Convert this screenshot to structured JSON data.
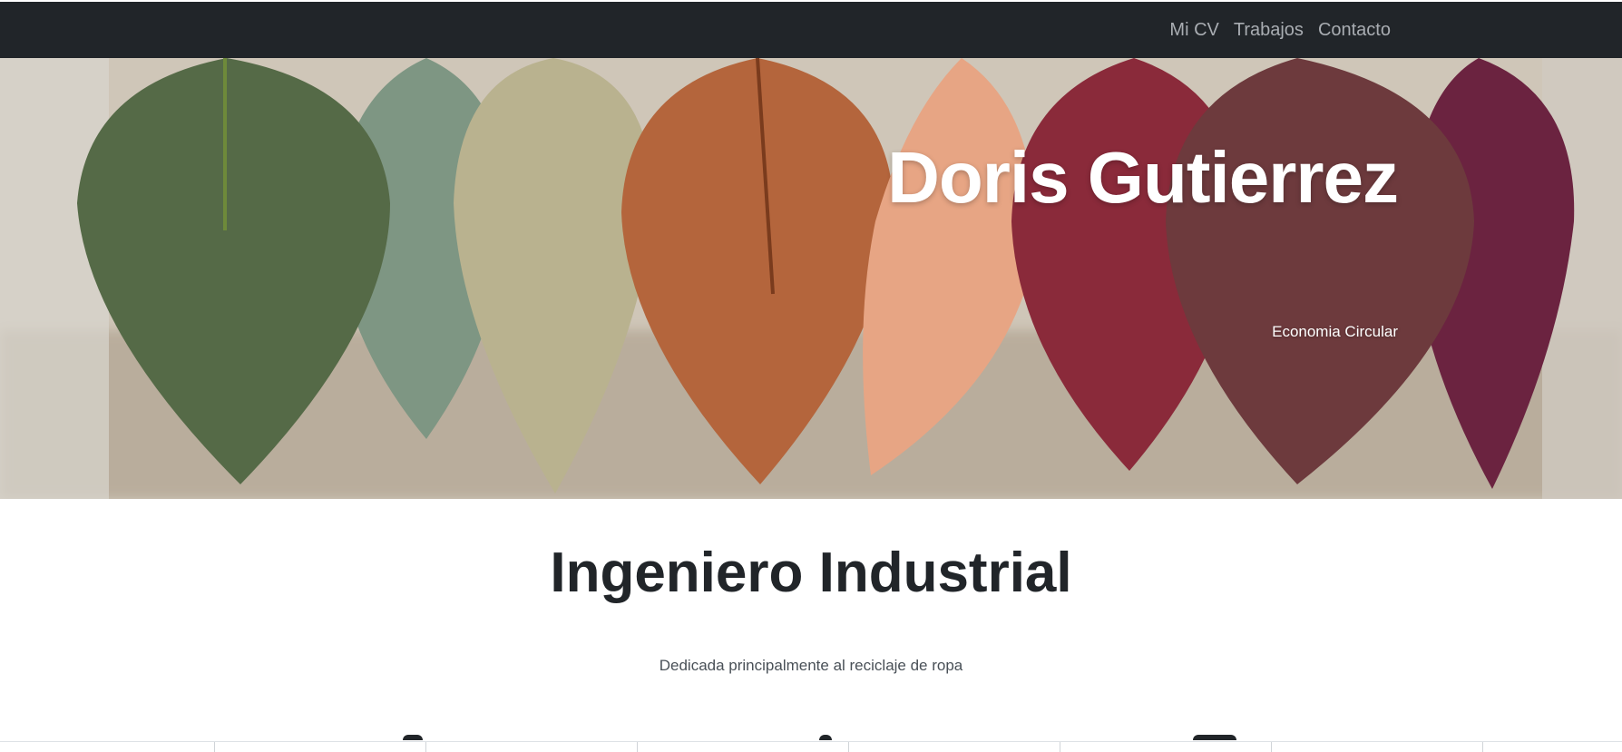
{
  "nav": {
    "items": [
      {
        "label": "Mi CV"
      },
      {
        "label": "Trabajos"
      },
      {
        "label": "Contacto"
      }
    ]
  },
  "hero": {
    "title": "Doris Gutierrez",
    "subtitle": "Economia Circular"
  },
  "intro": {
    "title": "Ingeniero Industrial",
    "description": "Dedicada principalmente al reciclaje de ropa"
  },
  "colors": {
    "navbar": "#212529",
    "nav_link": "#a9adb2",
    "heading": "#212529"
  }
}
